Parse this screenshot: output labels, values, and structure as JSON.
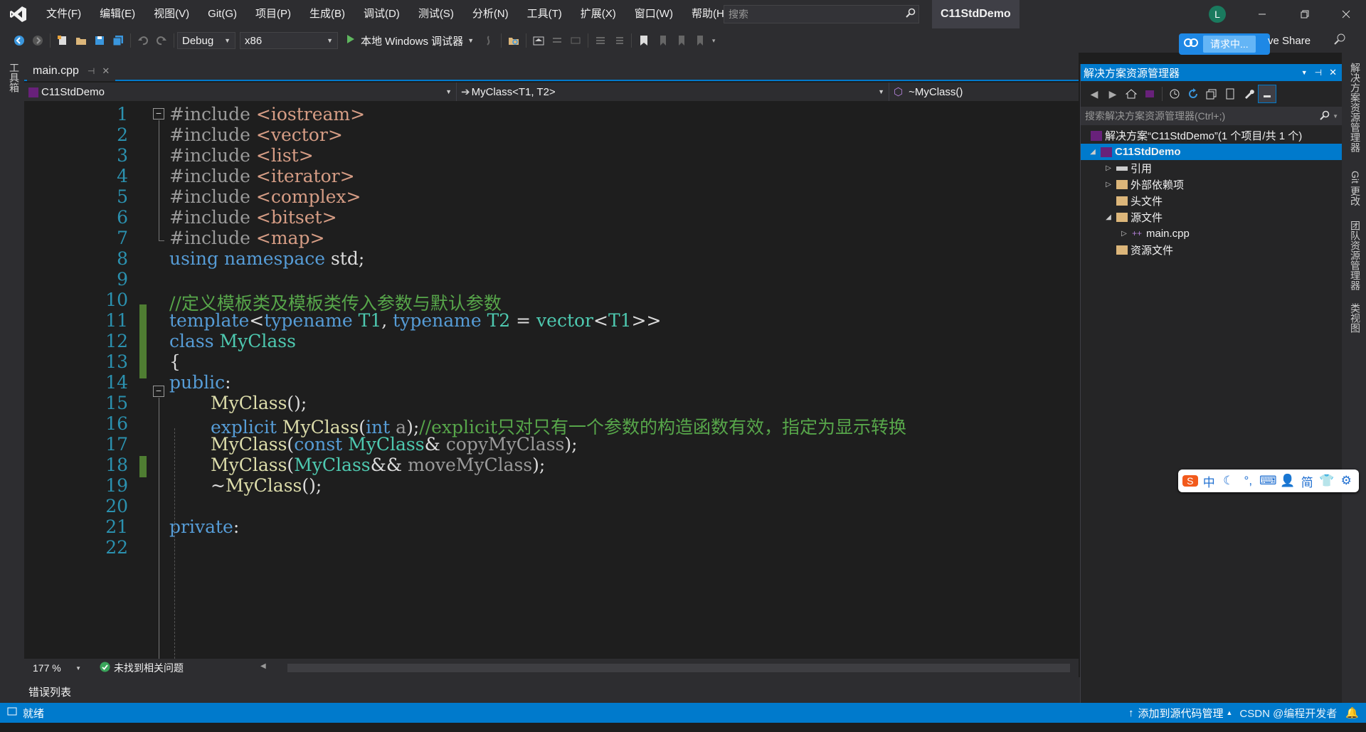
{
  "menu": [
    "文件(F)",
    "编辑(E)",
    "视图(V)",
    "Git(G)",
    "项目(P)",
    "生成(B)",
    "调试(D)",
    "测试(S)",
    "分析(N)",
    "工具(T)",
    "扩展(X)",
    "窗口(W)",
    "帮助(H)"
  ],
  "search": {
    "placeholder": "搜索"
  },
  "solution_title": "C11StdDemo",
  "avatar": "L",
  "toolbar": {
    "config": "Debug",
    "platform": "x86",
    "run_label": "本地 Windows 调试器"
  },
  "live_share": {
    "status": "请求中...",
    "label": "ve Share"
  },
  "toolbox_label": "工具箱",
  "editor": {
    "tab": "main.cpp",
    "nav": {
      "project": "C11StdDemo",
      "scope": "MyClass<T1, T2>",
      "member": "~MyClass()"
    },
    "line_numbers": [
      "1",
      "2",
      "3",
      "4",
      "5",
      "6",
      "7",
      "8",
      "9",
      "10",
      "11",
      "12",
      "13",
      "14",
      "15",
      "16",
      "17",
      "18",
      "19",
      "20",
      "21",
      "22"
    ],
    "includes": [
      "iostream",
      "vector",
      "list",
      "iterator",
      "complex",
      "bitset",
      "map"
    ],
    "using_line": {
      "kw": "using namespace",
      "rest": " std;"
    },
    "comment_line": "//定义模板类及模板类传入参数与默认参数",
    "template_line": {
      "kw1": "template",
      "p1": "<",
      "kw2": "typename",
      "t1": " T1",
      "comma": ", ",
      "kw3": "typename",
      "t2": " T2",
      "eq": " = ",
      "vec": "vector",
      "p2": "<",
      "t3": "T1",
      "p3": ">>"
    },
    "class_line": {
      "kw": "class",
      "name": " MyClass"
    },
    "brace": "{",
    "public": "public",
    "private": "private",
    "colon": ":",
    "ctor": "MyClass",
    "ctor_rest": "();",
    "explicit_line": {
      "kw": "explicit",
      "fn": " MyClass",
      "p": "(",
      "kw2": "int",
      "arg": " a",
      "p2": ");",
      "cm": "//explicit只对只有一个参数的构造函数有效，指定为显示转换"
    },
    "copy_line": {
      "fn": "MyClass",
      "p": "(",
      "kw": "const",
      "ty": " MyClass",
      "amp": "&",
      "arg": " copyMyClass",
      "p2": ");"
    },
    "move_line": {
      "fn": "MyClass",
      "p": "(",
      "ty": "MyClass",
      "amp": "&&",
      "arg": " moveMyClass",
      "p2": ");"
    },
    "dtor_line": {
      "tilde": "~",
      "fn": "MyClass",
      "p": "();"
    },
    "zoom": "177 %",
    "issues": "未找到相关问题"
  },
  "error_list": "错误列表",
  "solution_explorer": {
    "title": "解决方案资源管理器",
    "search_placeholder": "搜索解决方案资源管理器(Ctrl+;)",
    "items": [
      {
        "label": "解决方案“C11StdDemo”(1 个项目/共 1 个)"
      },
      {
        "label": "C11StdDemo"
      },
      {
        "label": "引用"
      },
      {
        "label": "外部依赖项"
      },
      {
        "label": "头文件"
      },
      {
        "label": "源文件"
      },
      {
        "label": "main.cpp"
      },
      {
        "label": "资源文件"
      }
    ]
  },
  "right_tabs": [
    "解决方案资源管理器",
    "Git 更改",
    "团队资源管理器",
    "类视图"
  ],
  "ime": [
    "中",
    "简"
  ],
  "status": {
    "left": "就绪",
    "right": "添加到源代码管理",
    "watermark": "CSDN @编程开发者"
  },
  "colors": {
    "accent": "#007acc",
    "keyword": "#569cd6",
    "type": "#4ec9b0",
    "function": "#dcdcaa",
    "comment": "#57a64a",
    "line_number": "#2b91af"
  }
}
